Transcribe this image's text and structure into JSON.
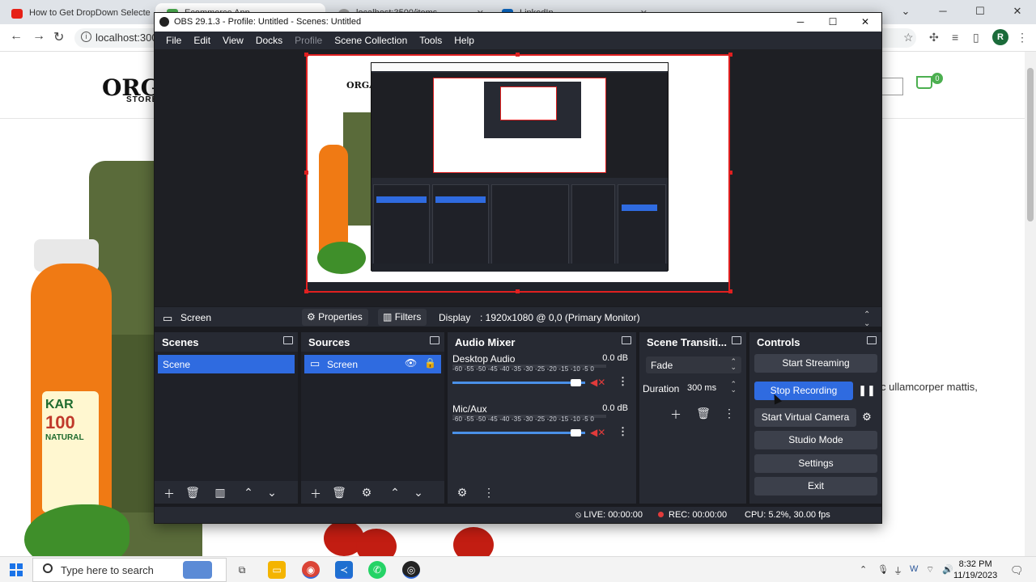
{
  "browser": {
    "tabs": [
      {
        "title": "How to Get DropDown Selecte",
        "active": false
      },
      {
        "title": "Ecommerce App",
        "active": true
      },
      {
        "title": "localhost:3500/items",
        "active": false
      },
      {
        "title": "LinkedIn",
        "active": false
      }
    ],
    "url": "localhost:3000",
    "profile_initial": "R",
    "cart_count": "0"
  },
  "webpage": {
    "logo": "ORGAN",
    "logo_sub": "STORE",
    "jar_brand": "KAR",
    "jar_number": "100",
    "jar_line": "NATURAL",
    "body_text": "c ullamcorper mattis,"
  },
  "obs": {
    "window_title": "OBS 29.1.3 - Profile: Untitled - Scenes: Untitled",
    "menu": [
      "File",
      "Edit",
      "View",
      "Docks",
      "Profile",
      "Scene Collection",
      "Tools",
      "Help"
    ],
    "preview_logo": "ORGA",
    "source_toolbar": {
      "selected_source": "Screen",
      "properties_label": "Properties",
      "filters_label": "Filters",
      "display_label": "Display",
      "display_value": ": 1920x1080 @ 0,0 (Primary Monitor)"
    },
    "scenes": {
      "title": "Scenes",
      "items": [
        "Scene"
      ]
    },
    "sources": {
      "title": "Sources",
      "items": [
        "Screen"
      ]
    },
    "mixer": {
      "title": "Audio Mixer",
      "scale": "-60 -55 -50 -45 -40 -35 -30 -25 -20 -15 -10 -5 0",
      "channels": [
        {
          "name": "Desktop Audio",
          "db": "0.0 dB"
        },
        {
          "name": "Mic/Aux",
          "db": "0.0 dB"
        }
      ]
    },
    "transitions": {
      "title": "Scene Transiti...",
      "selected": "Fade",
      "duration_label": "Duration",
      "duration_value": "300 ms"
    },
    "controls": {
      "title": "Controls",
      "start_streaming": "Start Streaming",
      "stop_recording": "Stop Recording",
      "start_virtual_camera": "Start Virtual Camera",
      "studio_mode": "Studio Mode",
      "settings": "Settings",
      "exit": "Exit"
    },
    "status": {
      "live": "LIVE: 00:00:00",
      "rec": "REC: 00:00:00",
      "cpu": "CPU: 5.2%, 30.00 fps"
    }
  },
  "taskbar": {
    "search_placeholder": "Type here to search",
    "time": "8:32 PM",
    "date": "11/19/2023"
  },
  "colors": {
    "obs_bg": "#272a33",
    "obs_dock_body": "#1f2128",
    "obs_accent": "#2f6be0",
    "preview_border": "#e02020",
    "record_red": "#e23b3b"
  }
}
